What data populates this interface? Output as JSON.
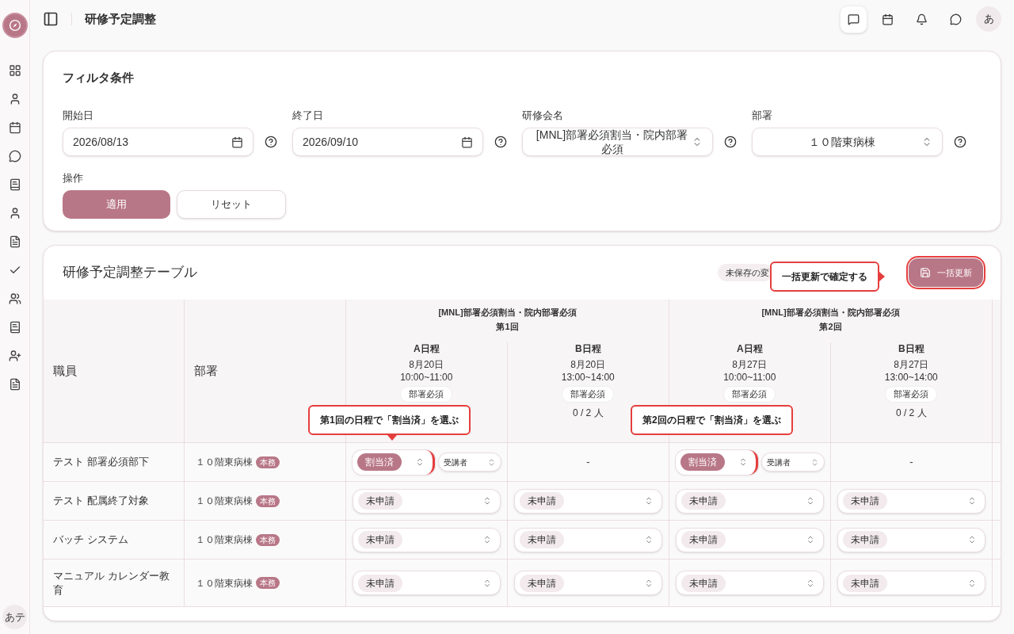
{
  "app": {
    "avatar": "あテ"
  },
  "header": {
    "title": "研修予定調整",
    "actions": [
      {
        "selected": true
      },
      {
        "selected": false
      },
      {
        "selected": false
      },
      {
        "selected": false
      }
    ],
    "avatar": "あ"
  },
  "filter": {
    "title": "フィルタ条件",
    "fields": [
      {
        "label": "開始日",
        "kind": "date",
        "value": "2026/08/13"
      },
      {
        "label": "終了日",
        "kind": "date",
        "value": "2026/09/10"
      },
      {
        "label": "研修会名",
        "kind": "select",
        "value": "[MNL]部署必須割当・院内部署必須"
      },
      {
        "label": "部署",
        "kind": "select",
        "value": "１０階東病棟"
      }
    ],
    "actions_label": "操作",
    "buttons": [
      {
        "label": "適用",
        "kind": "primary"
      },
      {
        "label": "リセット",
        "kind": "secondary"
      }
    ]
  },
  "table": {
    "title": "研修予定調整テーブル",
    "unsaved_badge": "未保存の変",
    "bulk_button": "一括更新",
    "columns": [
      "職員",
      "部署"
    ],
    "groups": [
      {
        "title": "[MNL]部署必須割当・院内部署必須",
        "round": "第1回",
        "schedules": [
          {
            "name": "A日程",
            "date": "8月20日",
            "time": "10:00~11:00",
            "tag": "部署必須"
          },
          {
            "name": "B日程",
            "date": "8月20日",
            "time": "13:00~14:00",
            "tag": "部署必須",
            "count": "0 / 2 人"
          }
        ]
      },
      {
        "title": "[MNL]部署必須割当・院内部署必須",
        "round": "第2回",
        "schedules": [
          {
            "name": "A日程",
            "date": "8月27日",
            "time": "10:00~11:00",
            "tag": "部署必須"
          },
          {
            "name": "B日程",
            "date": "8月27日",
            "time": "13:00~14:00",
            "tag": "部署必須",
            "count": "0 / 2 人"
          }
        ]
      }
    ],
    "rows": [
      {
        "name": "テスト 部署必須部下",
        "dept": "１０階東病棟",
        "dept_badge": "本務",
        "cells": [
          {
            "kind": "select",
            "status": "割当済",
            "assigned": true,
            "highlighted": true,
            "role": "受講者"
          },
          {
            "kind": "empty",
            "text": "-"
          },
          {
            "kind": "select",
            "status": "割当済",
            "assigned": true,
            "highlighted": true,
            "role": "受講者"
          },
          {
            "kind": "empty",
            "text": "-"
          }
        ]
      },
      {
        "name": "テスト 配属終了対象",
        "dept": "１０階東病棟",
        "dept_badge": "本務",
        "cells": [
          {
            "kind": "select",
            "status": "未申請",
            "assigned": false,
            "highlighted": false
          },
          {
            "kind": "select",
            "status": "未申請",
            "assigned": false,
            "highlighted": false
          },
          {
            "kind": "select",
            "status": "未申請",
            "assigned": false,
            "highlighted": false
          },
          {
            "kind": "select",
            "status": "未申請",
            "assigned": false,
            "highlighted": false
          }
        ]
      },
      {
        "name": "バッチ システム",
        "dept": "１０階東病棟",
        "dept_badge": "本務",
        "cells": [
          {
            "kind": "select",
            "status": "未申請",
            "assigned": false,
            "highlighted": false
          },
          {
            "kind": "select",
            "status": "未申請",
            "assigned": false,
            "highlighted": false
          },
          {
            "kind": "select",
            "status": "未申請",
            "assigned": false,
            "highlighted": false
          },
          {
            "kind": "select",
            "status": "未申請",
            "assigned": false,
            "highlighted": false
          }
        ]
      },
      {
        "name": "マニュアル カレンダー教育",
        "dept": "１０階東病棟",
        "dept_badge": "本務",
        "cells": [
          {
            "kind": "select",
            "status": "未申請",
            "assigned": false,
            "highlighted": false
          },
          {
            "kind": "select",
            "status": "未申請",
            "assigned": false,
            "highlighted": false
          },
          {
            "kind": "select",
            "status": "未申請",
            "assigned": false,
            "highlighted": false
          },
          {
            "kind": "select",
            "status": "未申請",
            "assigned": false,
            "highlighted": false
          }
        ]
      }
    ]
  },
  "callouts": [
    {
      "text": "一括更新で確定する",
      "kind": "right"
    },
    {
      "text": "第1回の日程で「割当済」を選ぶ",
      "kind": "down"
    },
    {
      "text": "第2回の日程で「割当済」を選ぶ",
      "kind": "plain"
    }
  ]
}
